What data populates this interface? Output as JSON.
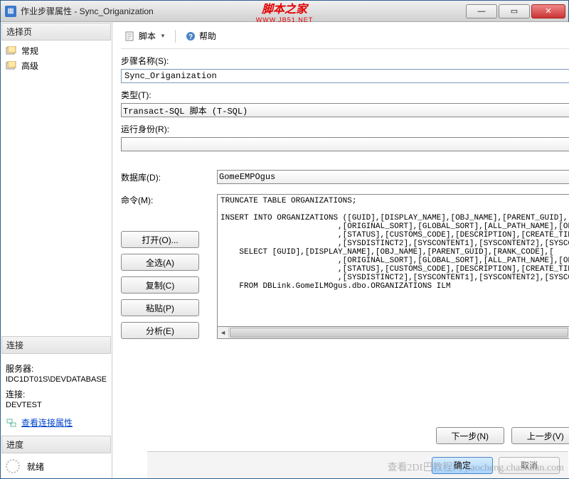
{
  "title": "作业步骤属性 - Sync_Origanization",
  "watermark": {
    "top": "脚本之家",
    "sub": "WWW.JB51.NET"
  },
  "win": {
    "min": "—",
    "max": "▭",
    "close": "✕"
  },
  "sidebar": {
    "select_page": "选择页",
    "items": [
      "常规",
      "高级"
    ],
    "connection_hdr": "连接",
    "server_label": "服务器:",
    "server_value": "IDC1DT01S\\DEVDATABASE",
    "conn_label": "连接:",
    "conn_value": "DEVTEST",
    "view_link": "查看连接属性",
    "progress_hdr": "进度",
    "ready": "就绪"
  },
  "toolbar": {
    "script": "脚本",
    "help": "帮助"
  },
  "form": {
    "step_name_label": "步骤名称(S):",
    "step_name_value": "Sync_Origanization",
    "type_label": "类型(T):",
    "type_value": "Transact-SQL 脚本 (T-SQL)",
    "runas_label": "运行身份(R):",
    "runas_value": "",
    "database_label": "数据库(D):",
    "database_value": "GomeEMPOgus",
    "command_label": "命令(M):"
  },
  "cmd_buttons": {
    "open": "打开(O)...",
    "select_all": "全选(A)",
    "copy": "复制(C)",
    "paste": "粘贴(P)",
    "analyze": "分析(E)"
  },
  "sql": "TRUNCATE TABLE ORGANIZATIONS;\n\nINSERT INTO ORGANIZATIONS ([GUID],[DISPLAY_NAME],[OBJ_NAME],[PARENT_GUID],[\n                         ,[ORIGINAL_SORT],[GLOBAL_SORT],[ALL_PATH_NAME],[ORG\n                         ,[STATUS],[CUSTOMS_CODE],[DESCRIPTION],[CREATE_TIME\n                         ,[SYSDISTINCT2],[SYSCONTENT1],[SYSCONTENT2],[SYSCON\n    SELECT [GUID],[DISPLAY_NAME],[OBJ_NAME],[PARENT_GUID],[RANK_CODE],[\n                         ,[ORIGINAL_SORT],[GLOBAL_SORT],[ALL_PATH_NAME],[ORG\n                         ,[STATUS],[CUSTOMS_CODE],[DESCRIPTION],[CREATE_TIME\n                         ,[SYSDISTINCT2],[SYSCONTENT1],[SYSCONTENT2],[SYSCON\n    FROM DBLink.GomeILMOgus.dbo.ORGANIZATIONS ILM",
  "nav": {
    "next": "下一步(N)",
    "prev": "上一步(V)"
  },
  "footer": {
    "ok": "确定",
    "cancel": "取消"
  },
  "corner_wm": "查看2DI巴教程网\njiaocheng.chazidian.com"
}
